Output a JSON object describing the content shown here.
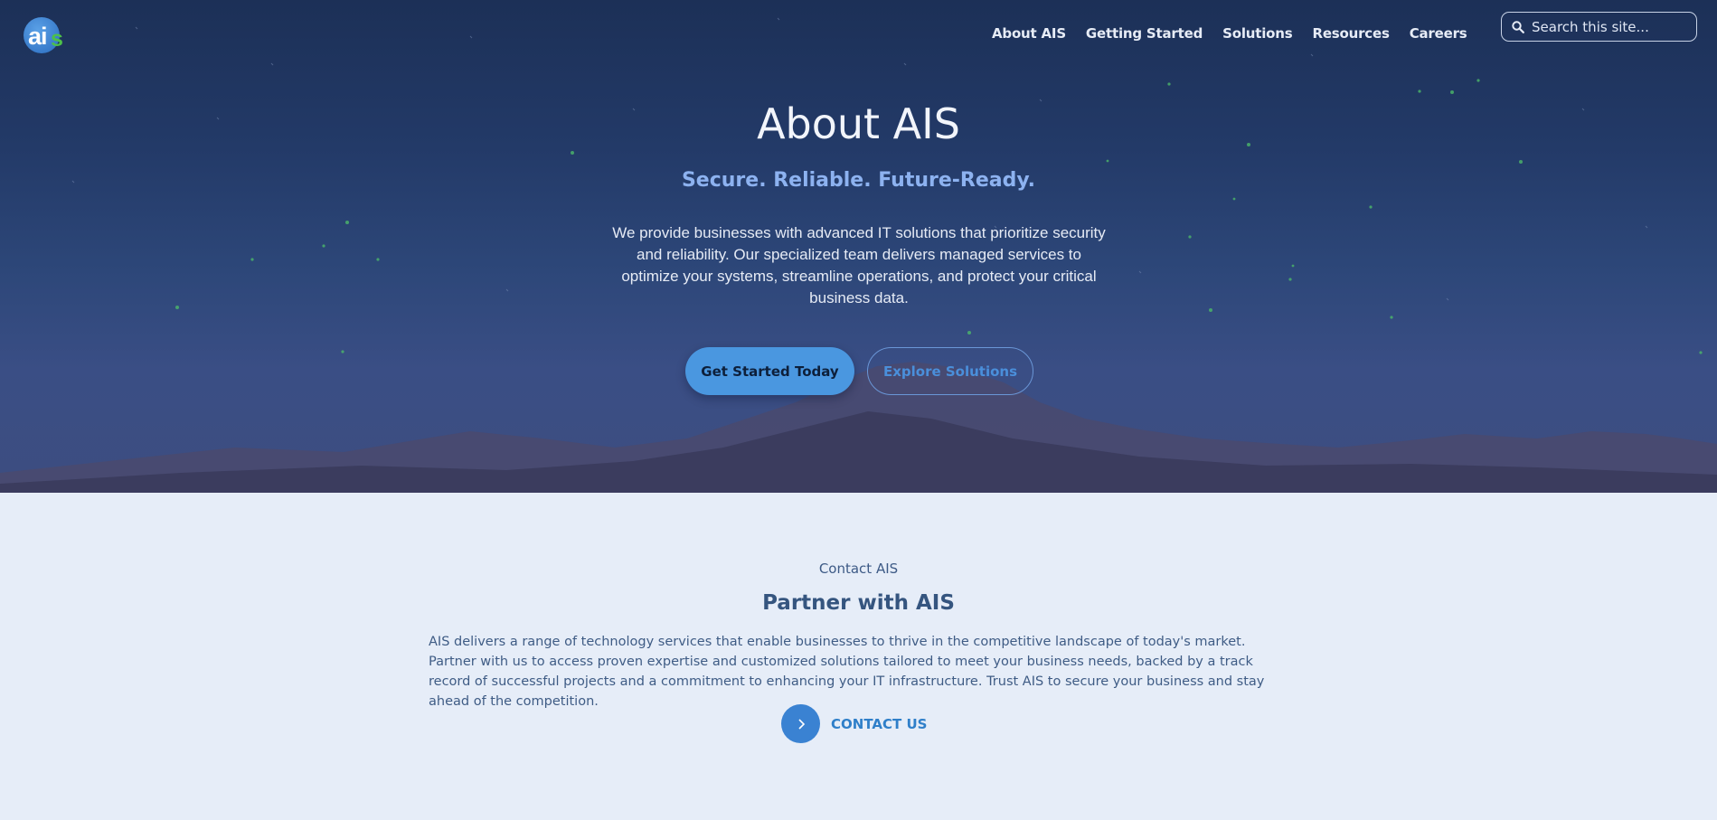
{
  "brand": {
    "logo_text_main": "ai",
    "logo_text_accent": "s"
  },
  "nav": {
    "items": [
      {
        "label": "About AIS"
      },
      {
        "label": "Getting Started"
      },
      {
        "label": "Solutions"
      },
      {
        "label": "Resources"
      },
      {
        "label": "Careers"
      }
    ]
  },
  "search": {
    "placeholder": "Search this site..."
  },
  "hero": {
    "title": "About AIS",
    "tagline": "Secure. Reliable. Future-Ready.",
    "description": "We provide businesses with advanced IT solutions that prioritize security and reliability. Our specialized team delivers managed services to optimize your systems, streamline operations, and protect your critical business data.",
    "primary_button": "Get Started Today",
    "secondary_button": "Explore Solutions"
  },
  "contact": {
    "eyebrow": "Contact AIS",
    "title": "Partner with AIS",
    "description": "AIS delivers a range of technology services that enable businesses to thrive in the competitive landscape of today's market. Partner with us to access proven expertise and customized solutions tailored to meet your business needs, backed by a track record of successful projects and a commitment to enhancing your IT infrastructure. Trust AIS to secure your business and stay ahead of the competition.",
    "link_label": "CONTACT US"
  },
  "colors": {
    "accent": "#4a97e0",
    "tagline": "#8db2f0",
    "logo_green": "#4cc04a"
  }
}
